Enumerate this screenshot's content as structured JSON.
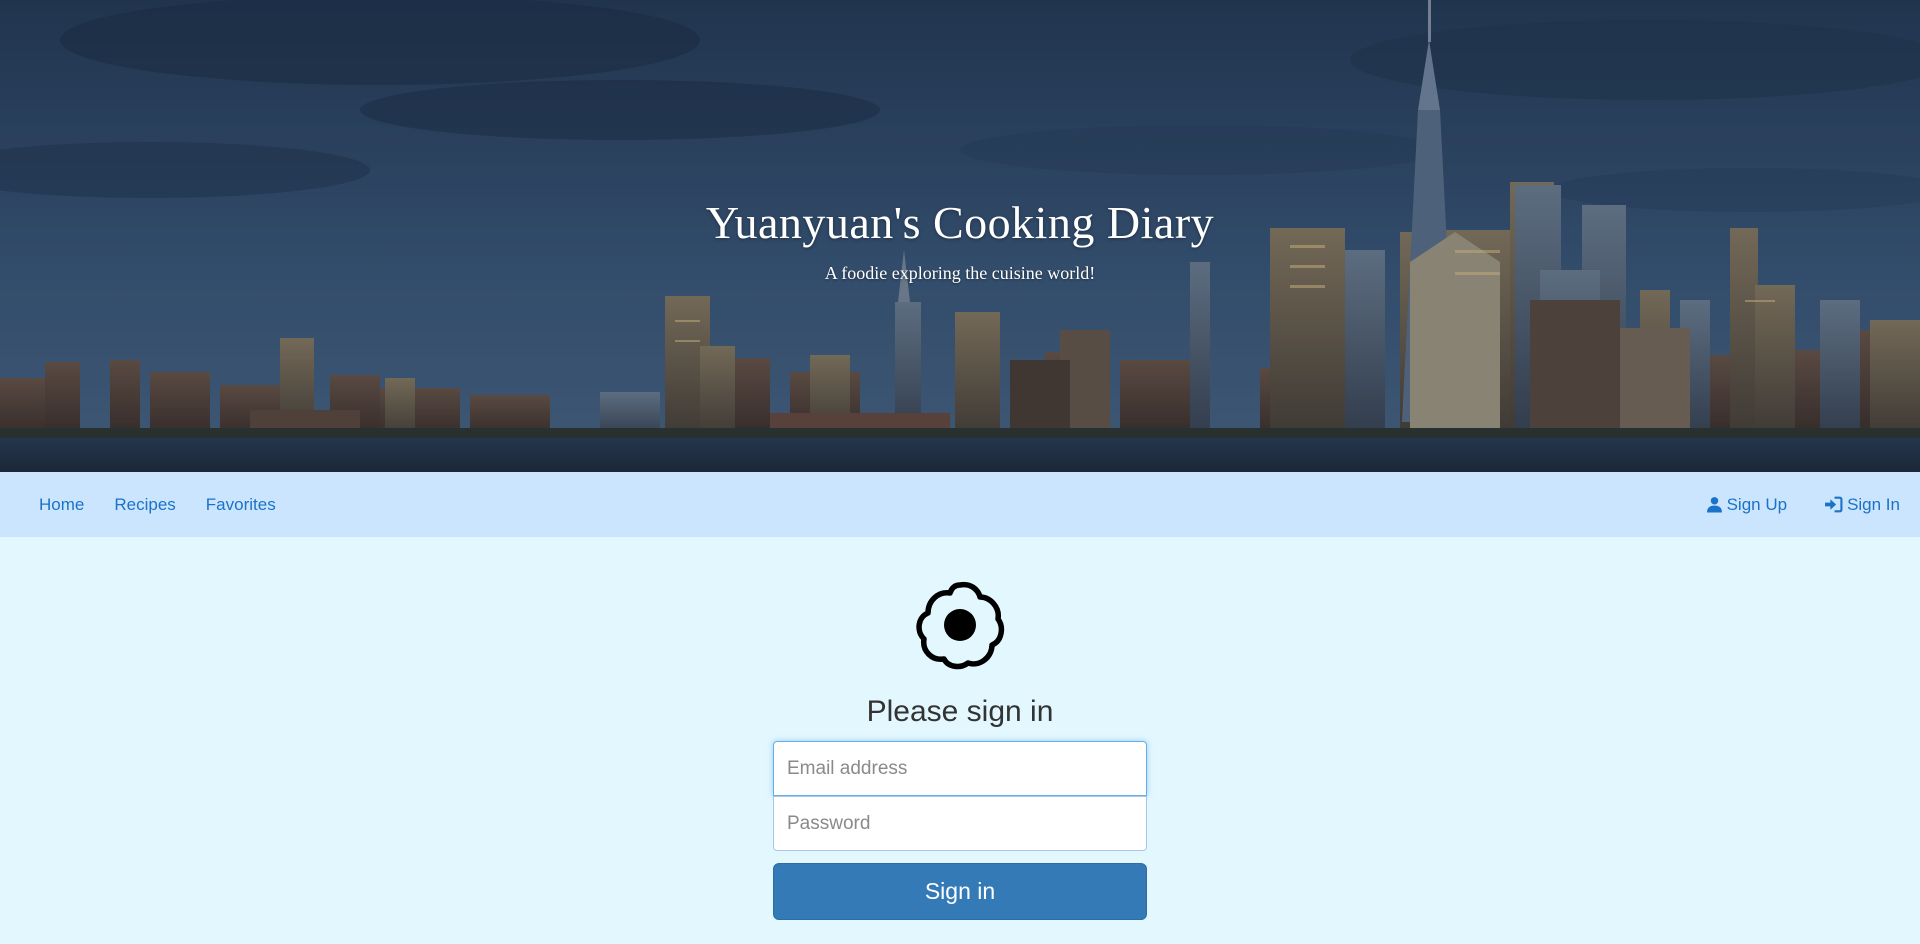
{
  "hero": {
    "title": "Yuanyuan's Cooking Diary",
    "subtitle": "A foodie exploring the cuisine world!"
  },
  "navbar": {
    "left_items": [
      {
        "label": "Home"
      },
      {
        "label": "Recipes"
      },
      {
        "label": "Favorites"
      }
    ],
    "right_items": [
      {
        "label": "Sign Up",
        "icon": "user-icon"
      },
      {
        "label": "Sign In",
        "icon": "log-in-icon"
      }
    ]
  },
  "signin": {
    "logo_icon": "fried-egg-icon",
    "heading": "Please sign in",
    "email_placeholder": "Email address",
    "password_placeholder": "Password",
    "button_label": "Sign in"
  },
  "colors": {
    "navbar_bg": "#cce5ff",
    "page_bg": "#e3f7ff",
    "link": "#1a73c8",
    "primary_button": "#337ab7"
  }
}
